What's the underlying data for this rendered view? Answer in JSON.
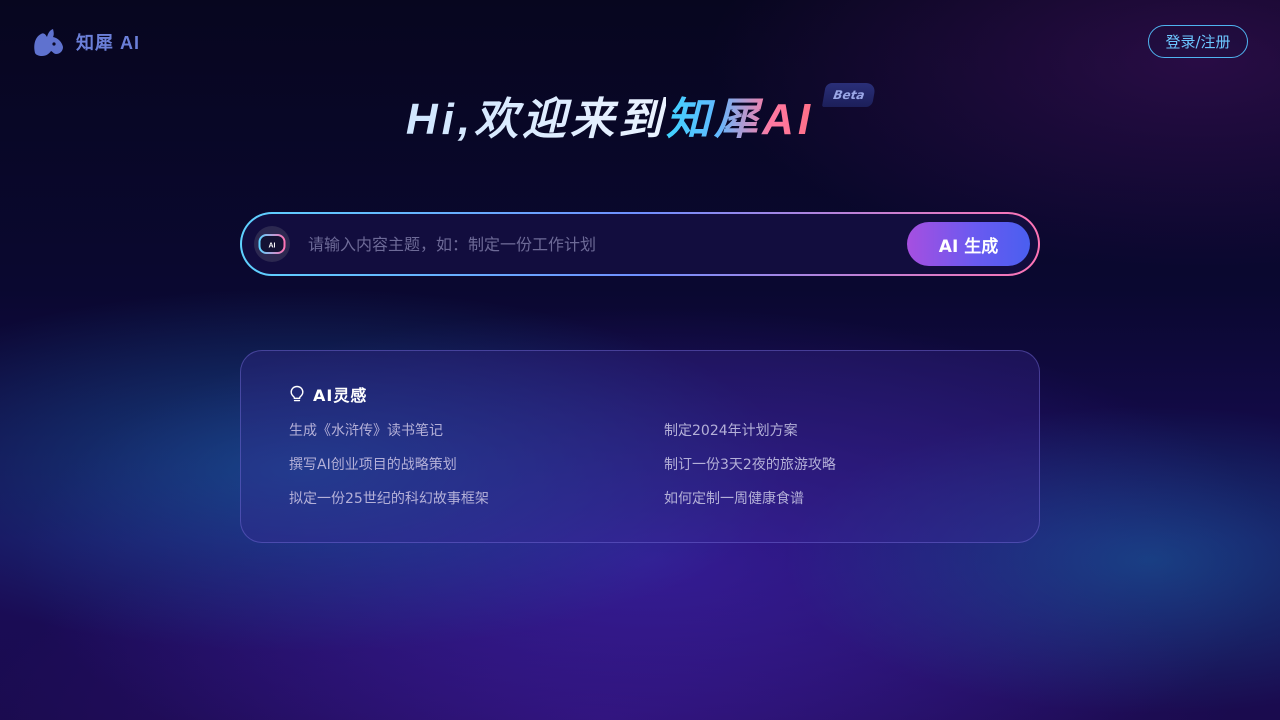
{
  "header": {
    "logo_text": "知犀 AI",
    "logo_icon": "rhino-icon",
    "login_label": "登录/注册"
  },
  "hero": {
    "greeting": "Hi,欢迎来到",
    "brand": "知犀AI",
    "badge": "Beta"
  },
  "search": {
    "icon": "ai-bot-icon",
    "icon_label": "AI",
    "placeholder": "请输入内容主题，如：制定一份工作计划",
    "button_label": "AI 生成"
  },
  "inspiration": {
    "icon": "lightbulb-icon",
    "title": "AI灵感",
    "suggestions": [
      "生成《水浒传》读书笔记",
      "制定2024年计划方案",
      "撰写AI创业项目的战略策划",
      "制订一份3天2夜的旅游攻略",
      "拟定一份25世纪的科幻故事框架",
      "如何定制一周健康食谱"
    ]
  },
  "colors": {
    "accent_cyan": "#5fd2ff",
    "accent_pink": "#ff74b5",
    "button_purple": "#a64fe0",
    "button_blue": "#4a5ff0",
    "background": "#0a0826"
  }
}
